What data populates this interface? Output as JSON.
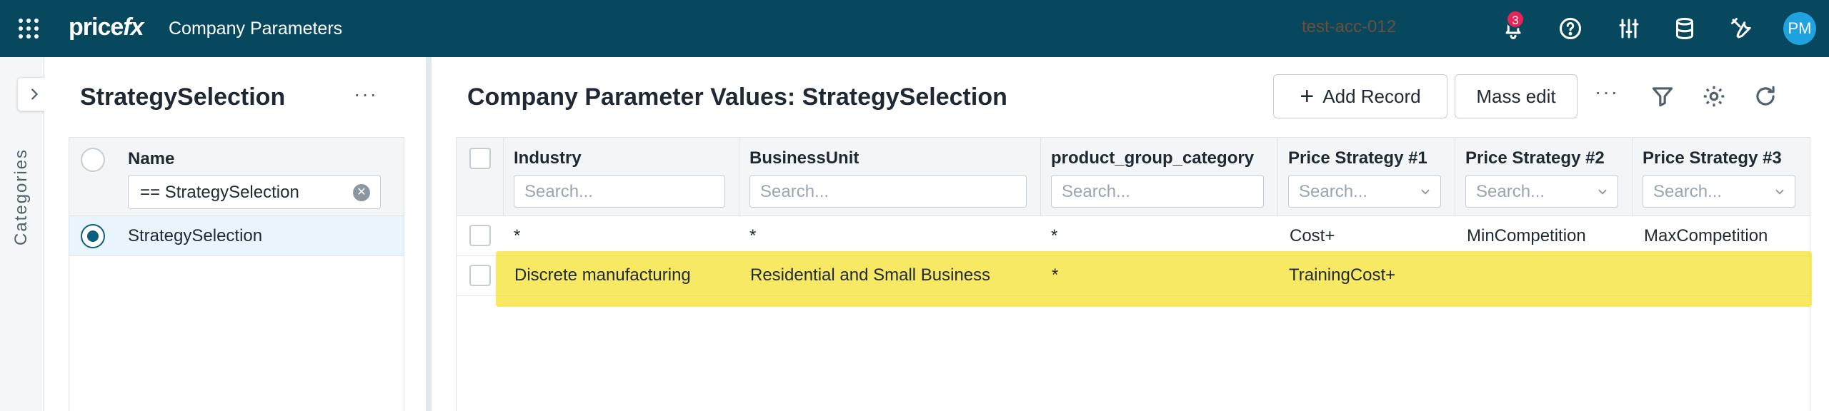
{
  "header": {
    "logo_price": "price",
    "logo_fx": "fx",
    "app_title": "Company Parameters",
    "environment": "test-acc-012",
    "notification_count": "3",
    "avatar_initials": "PM",
    "bar_color": "#08485f"
  },
  "rail": {
    "label": "Categories"
  },
  "left_panel": {
    "title": "StrategySelection",
    "more": "···",
    "column_header": "Name",
    "filter_value": "== StrategySelection",
    "rows": [
      {
        "name": "StrategySelection",
        "selected": true
      }
    ]
  },
  "main": {
    "title": "Company Parameter Values: StrategySelection",
    "add_record_label": "Add Record",
    "mass_edit_label": "Mass edit",
    "more": "···",
    "columns": [
      {
        "name": "Industry",
        "placeholder": "Search..."
      },
      {
        "name": "BusinessUnit",
        "placeholder": "Search..."
      },
      {
        "name": "product_group_category",
        "placeholder": "Search..."
      },
      {
        "name": "Price Strategy #1",
        "placeholder": "Search..."
      },
      {
        "name": "Price Strategy #2",
        "placeholder": "Search..."
      },
      {
        "name": "Price Strategy #3",
        "placeholder": "Search..."
      }
    ],
    "rows": [
      [
        "*",
        "*",
        "*",
        "Cost+",
        "MinCompetition",
        "MaxCompetition"
      ],
      [
        "Discrete manufacturing",
        "Residential and Small Business",
        "*",
        "TrainingCost+",
        "",
        ""
      ]
    ],
    "highlight_color": "#f5e028"
  }
}
